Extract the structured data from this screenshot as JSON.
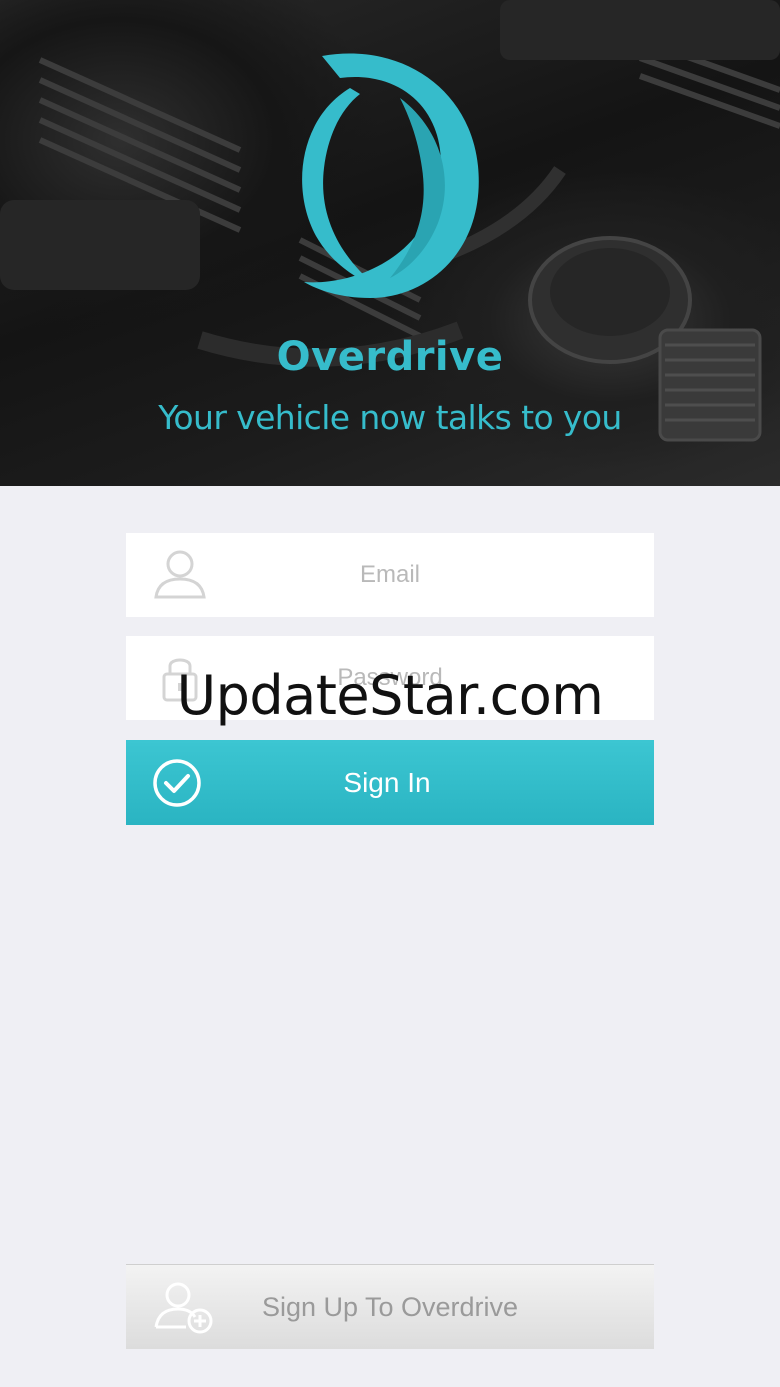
{
  "hero": {
    "brand_name": "Overdrive",
    "tagline": "Your vehicle now talks to you"
  },
  "login": {
    "email_placeholder": "Email",
    "password_placeholder": "Password",
    "signin_label": "Sign In"
  },
  "signup": {
    "label": "Sign Up To Overdrive"
  },
  "watermark": "UpdateStar.com",
  "colors": {
    "accent": "#36bccb",
    "background": "#efeff4"
  },
  "icons": {
    "logo": "overdrive-swirl-logo",
    "email": "user-icon",
    "password": "lock-icon",
    "signin": "check-circle-icon",
    "signup": "add-user-icon"
  }
}
